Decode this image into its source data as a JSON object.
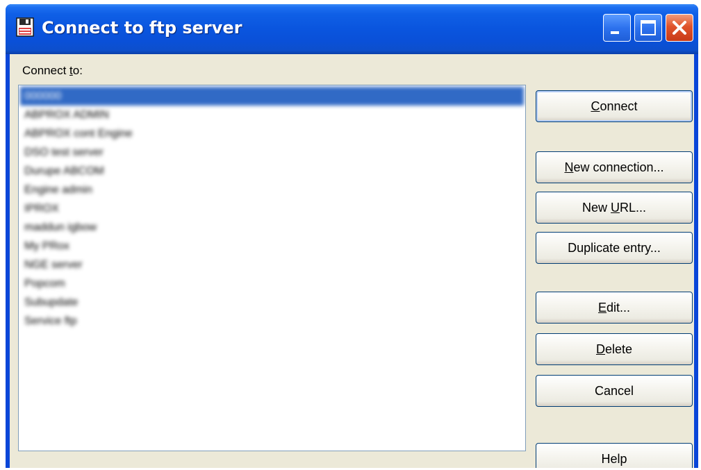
{
  "window": {
    "title": "Connect to ftp server"
  },
  "connect_label": {
    "accel": "t",
    "before": "Connect ",
    "after": "o:"
  },
  "list": {
    "items": [
      "000000",
      "ABPROX ADMIN",
      "ABPROX cont Engine",
      "DSO test server",
      "Durupe ABCOM",
      "Engine admin",
      "IPROX",
      "maddun igbow",
      "My PRox",
      "NGE server",
      "Popcom",
      "Subupdate",
      "Service ftp"
    ],
    "selected_index": 0
  },
  "buttons": {
    "connect": {
      "accel": "C",
      "rest": "onnect"
    },
    "new_connection": {
      "accel": "N",
      "rest": "ew connection..."
    },
    "new_url": {
      "before": "New ",
      "accel": "U",
      "rest": "RL..."
    },
    "duplicate": {
      "label": "Duplicate entry..."
    },
    "edit": {
      "accel": "E",
      "rest": "dit..."
    },
    "delete": {
      "accel": "D",
      "rest": "elete"
    },
    "cancel": {
      "label": "Cancel"
    },
    "help": {
      "label": "Help"
    }
  },
  "colors": {
    "titlebar": "#0a55de",
    "client_bg": "#ece9d8",
    "selection": "#316ac5",
    "close_button": "#e0532b"
  }
}
